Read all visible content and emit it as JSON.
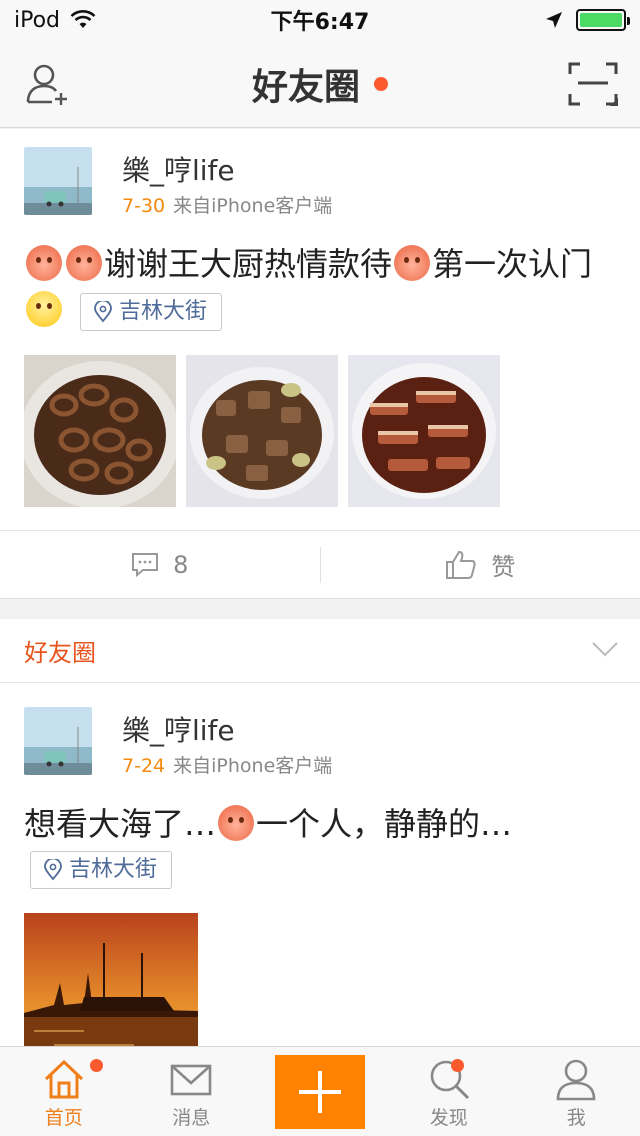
{
  "status_bar": {
    "carrier": "iPod",
    "time": "下午6:47",
    "battery_percent": 100
  },
  "nav": {
    "title": "好友圈"
  },
  "feed": {
    "post1": {
      "username": "樂_哼life",
      "date": "7-30",
      "source": "来自iPhone客户端",
      "text_part1": "谢谢王大厨热情款待",
      "text_part2": "第一次认门",
      "location": "吉林大街",
      "comments_count": "8",
      "like_label": "赞"
    },
    "section_header": "好友圈",
    "post2": {
      "username": "樂_哼life",
      "date": "7-24",
      "source": "来自iPhone客户端",
      "text_part1": "想看大海了…",
      "text_part2": "一个人，静静的…",
      "location": "吉林大街"
    }
  },
  "tabs": [
    {
      "label": "首页"
    },
    {
      "label": "消息"
    },
    {
      "label": "发现"
    },
    {
      "label": "我"
    }
  ],
  "colors": {
    "accent": "#ff8200",
    "badge": "#fa5a2d",
    "link": "#506c9a",
    "date": "#f28a10"
  }
}
